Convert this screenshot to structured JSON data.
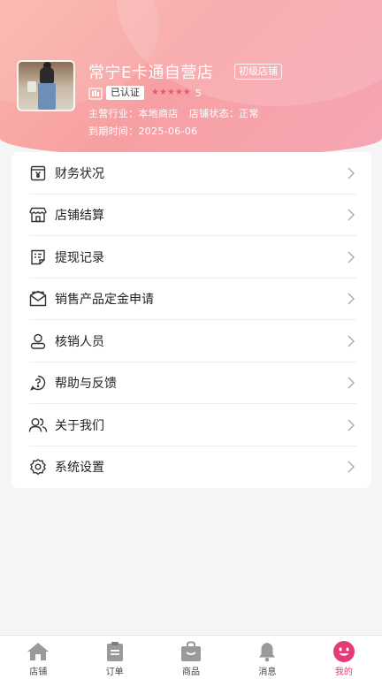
{
  "store": {
    "name": "常宁E卡通自营店",
    "level": "初级店铺",
    "verified": "已认证",
    "stars": 5,
    "rating": "5",
    "industry_label": "主营行业：",
    "industry_value": "本地商店",
    "status_label": "店铺状态：",
    "status_value": "正常",
    "expire_label": "到期时间：",
    "expire_value": "2025-06-06"
  },
  "menu": {
    "items": [
      {
        "label": "财务状况",
        "icon": "finance-icon"
      },
      {
        "label": "店铺结算",
        "icon": "store-settlement-icon"
      },
      {
        "label": "提现记录",
        "icon": "withdraw-record-icon"
      },
      {
        "label": "销售产品定金申请",
        "icon": "deposit-envelope-icon"
      },
      {
        "label": "核销人员",
        "icon": "staff-icon"
      },
      {
        "label": "帮助与反馈",
        "icon": "help-icon"
      },
      {
        "label": "关于我们",
        "icon": "about-users-icon"
      },
      {
        "label": "系统设置",
        "icon": "settings-icon"
      }
    ]
  },
  "tabbar": {
    "items": [
      {
        "label": "店铺",
        "icon": "home-icon"
      },
      {
        "label": "订单",
        "icon": "clipboard-icon"
      },
      {
        "label": "商品",
        "icon": "bag-icon"
      },
      {
        "label": "消息",
        "icon": "bell-icon"
      },
      {
        "label": "我的",
        "icon": "smile-icon",
        "active": true
      }
    ]
  },
  "colors": {
    "accent": "#e53a78",
    "header_start": "#fbb4a8",
    "header_end": "#f6a6b4"
  }
}
